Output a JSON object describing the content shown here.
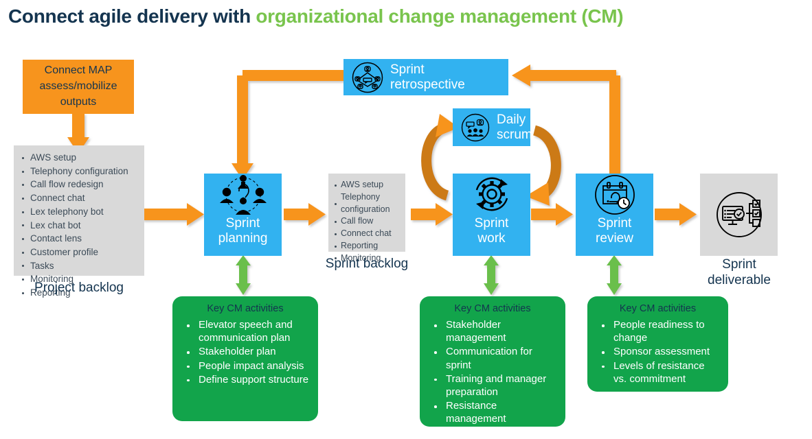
{
  "title": {
    "part1": "Connect agile delivery with ",
    "part2": "organizational change management (CM)"
  },
  "colors": {
    "navy": "#14344f",
    "green_accent": "#79c44d",
    "orange": "#f7941d",
    "blue": "#32b2f0",
    "green_box": "#12a44b",
    "gray": "#d9d9d9",
    "light_green_arrow": "#6abf4b"
  },
  "map_outputs": {
    "label": "Connect MAP assess/mobilize outputs"
  },
  "project_backlog": {
    "caption": "Project backlog",
    "items": [
      "AWS setup",
      "Telephony configuration",
      "Call flow redesign",
      "Connect chat",
      "Lex telephony bot",
      "Lex chat bot",
      "Contact lens",
      "Customer profile",
      "Tasks",
      "Monitoring",
      "Reporting"
    ]
  },
  "sprint_backlog": {
    "caption": "Sprint backlog",
    "items": [
      "AWS setup",
      "Telephony configuration",
      "Call flow",
      "Connect chat",
      "Reporting",
      "Monitoring"
    ]
  },
  "stages": {
    "planning": {
      "label": "Sprint planning",
      "icon": "team-collaboration-icon"
    },
    "work": {
      "label": "Sprint work",
      "icon": "gear-cycle-icon"
    },
    "review": {
      "label": "Sprint review",
      "icon": "calendar-clock-icon"
    },
    "retrospective": {
      "label": "Sprint retrospective",
      "icon": "meeting-table-icon"
    },
    "daily_scrum": {
      "label": "Daily scrum",
      "icon": "standup-group-icon"
    },
    "deliverable": {
      "label": "Sprint deliverable",
      "icon": "checklist-monitor-icon"
    }
  },
  "cm_activities": [
    {
      "title": "Key CM activities",
      "items": [
        "Elevator speech and communication plan",
        "Stakeholder plan",
        "People impact analysis",
        "Define support structure"
      ]
    },
    {
      "title": "Key CM activities",
      "items": [
        "Stakeholder management",
        "Communication for sprint",
        "Training and manager preparation",
        "Resistance management"
      ]
    },
    {
      "title": "Key CM activities",
      "items": [
        "People readiness to change",
        "Sponsor assessment",
        "Levels of resistance vs. commitment"
      ]
    }
  ]
}
